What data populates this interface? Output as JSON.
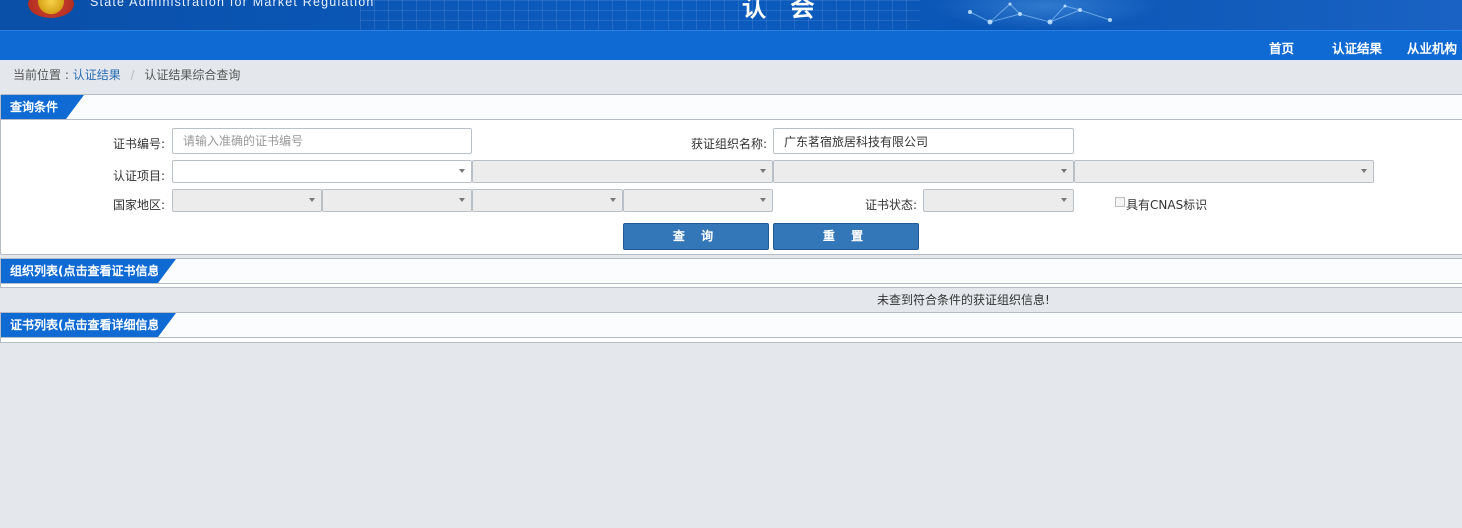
{
  "header": {
    "org_name_en": "State Administration  for  Market Regulation",
    "title_fragment": "认 会"
  },
  "nav": {
    "items": [
      "首页",
      "认证结果",
      "从业机构"
    ]
  },
  "breadcrumb": {
    "prefix": "当前位置 :",
    "link": "认证结果",
    "separator": "/",
    "current": "认证结果综合查询"
  },
  "query_panel": {
    "title": "查询条件",
    "cert_no_label": "证书编号:",
    "cert_no_placeholder": "请输入准确的证书编号",
    "org_name_label": "获证组织名称:",
    "org_name_value": "广东茗宿旅居科技有限公司",
    "cert_project_label": "认证项目:",
    "region_label": "国家地区:",
    "cert_status_label": "证书状态:",
    "cnas_label": "具有CNAS标识",
    "search_button": "查 询",
    "reset_button": "重 置"
  },
  "org_list_panel": {
    "title": "组织列表(点击查看证书信息)",
    "empty_message": "未查到符合条件的获证组织信息!"
  },
  "cert_list_panel": {
    "title": "证书列表(点击查看详细信息)"
  },
  "colors": {
    "brand_blue": "#0f6ad4",
    "button_blue": "#3477b8",
    "page_bg": "#e4e8ec"
  }
}
